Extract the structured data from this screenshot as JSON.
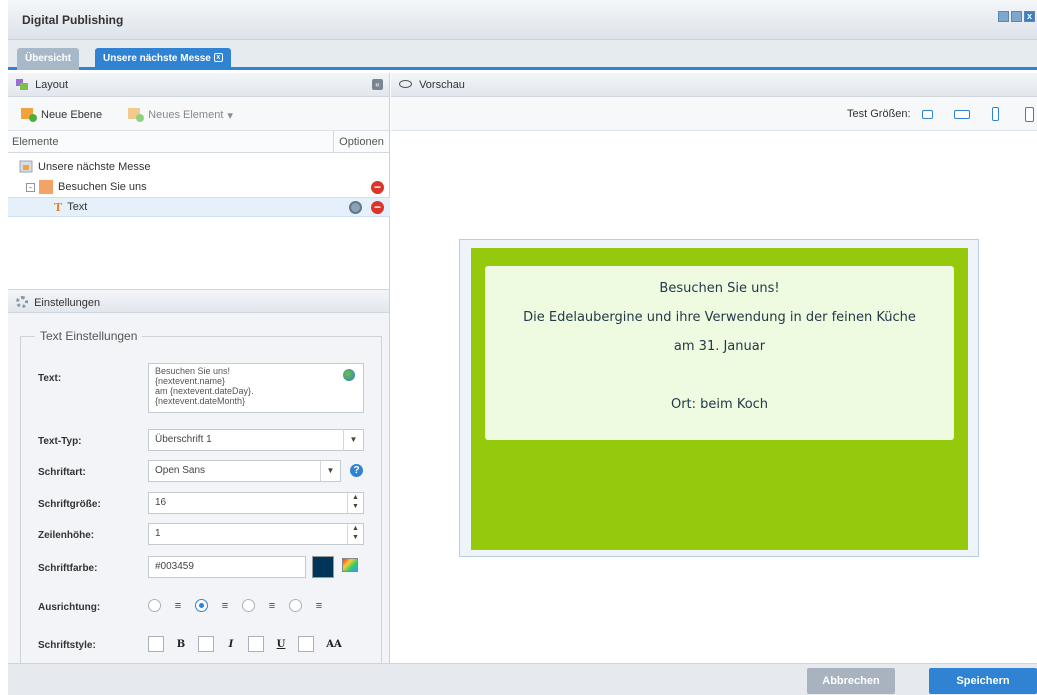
{
  "window": {
    "title": "Digital Publishing"
  },
  "tabs": [
    {
      "label": "Übersicht"
    },
    {
      "label": "Unsere nächste Messe"
    }
  ],
  "layout_panel": {
    "title": "Layout",
    "new_layer": "Neue Ebene",
    "new_element": "Neues Element",
    "col_elements": "Elemente",
    "col_options": "Optionen",
    "tree": [
      {
        "label": "Unsere nächste Messe"
      },
      {
        "label": "Besuchen Sie uns"
      },
      {
        "label": "Text"
      }
    ]
  },
  "settings": {
    "title": "Einstellungen",
    "legend": "Text Einstellungen",
    "text_label": "Text:",
    "text_lines": [
      "Besuchen Sie uns!",
      "{nextevent.name}",
      "am {nextevent.dateDay}.",
      "{nextevent.dateMonth}"
    ],
    "texttype_label": "Text-Typ:",
    "texttype_value": "Überschrift 1",
    "font_label": "Schriftart:",
    "font_value": "Open Sans",
    "size_label": "Schriftgröße:",
    "size_value": "16",
    "lineheight_label": "Zeilenhöhe:",
    "lineheight_value": "1",
    "color_label": "Schriftfarbe:",
    "color_value": "#003459",
    "align_label": "Ausrichtung:",
    "style_label": "Schriftstyle:",
    "style_bold": "B",
    "style_italic": "I",
    "style_underline": "U",
    "style_caps": "AA"
  },
  "preview": {
    "title": "Vorschau",
    "test_sizes": "Test Größen:",
    "lines": [
      "Besuchen Sie uns!",
      "Die Edelaubergine und ihre Verwendung in der feinen Küche",
      "am 31. Januar",
      "",
      "Ort: beim Koch"
    ]
  },
  "buttons": {
    "cancel": "Abbrechen",
    "save": "Speichern"
  },
  "colors": {
    "accent": "#2f83d2",
    "banner_green": "#95c90b",
    "text_color": "#003459",
    "delete_red": "#d9352b"
  }
}
